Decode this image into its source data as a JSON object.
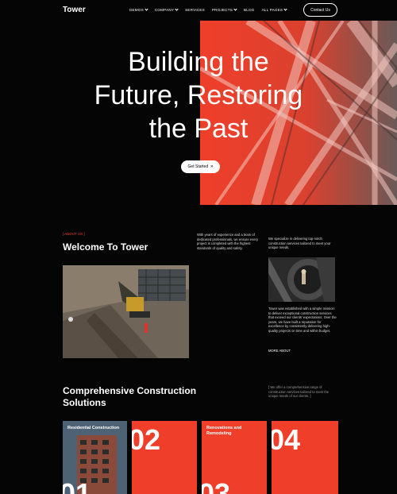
{
  "nav": {
    "logo": "Tower",
    "menu": [
      {
        "label": "DEMOS",
        "dropdown": true
      },
      {
        "label": "COMPANY",
        "dropdown": true
      },
      {
        "label": "SERVICES",
        "dropdown": false
      },
      {
        "label": "PROJECTS",
        "dropdown": true
      },
      {
        "label": "BLOG",
        "dropdown": false
      },
      {
        "label": "ALL PAGES",
        "dropdown": true
      }
    ],
    "contact": "Contact Us"
  },
  "hero": {
    "title_line1": "Building the",
    "title_line2": "Future, Restoring",
    "title_line3": "the Past",
    "button": "Get Started",
    "button_arrow": "»"
  },
  "about": {
    "tag": "[ ABOUT US ]",
    "title": "Welcome To Tower",
    "text1": "With years of experience and a team of dedicated professionals, we ensure every project is completed with the highest standards of quality and safety.",
    "text2": "We specialize in delivering top-notch construction services tailored to meet your unique needs.",
    "text3": "Tower was established with a simple mission: to deliver exceptional construction services that exceed our clients' expectations. Over the years, we have built a reputation for excellence by consistently delivering high-quality projects on time and within budget.",
    "more": "MORE ABOUT"
  },
  "services": {
    "title": "Comprehensive Construction Solutions",
    "text": "[ We offer a comprehensive range of construction services tailored to meet the unique needs of our clients. ]",
    "cards": [
      {
        "label": "Residential Construction",
        "number": "01"
      },
      {
        "label": "",
        "number": "02"
      },
      {
        "label": "Renovations and Remodeling",
        "number": "03"
      },
      {
        "label": "",
        "number": "04"
      }
    ]
  },
  "colors": {
    "accent": "#ef3f2a",
    "background": "#050505"
  }
}
